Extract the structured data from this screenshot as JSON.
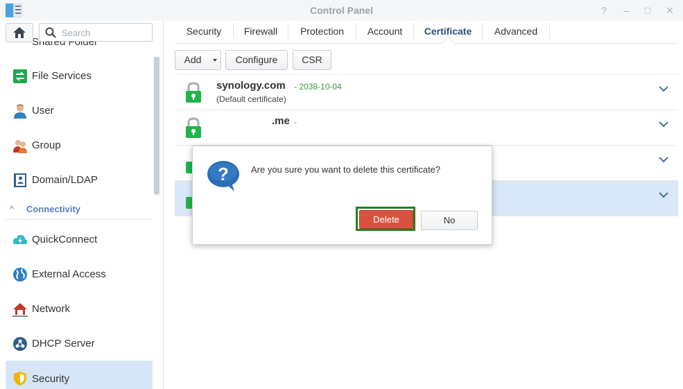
{
  "window": {
    "title": "Control Panel"
  },
  "window_controls": {
    "help": "?",
    "minimize": "–",
    "maximize": "□",
    "close": "×"
  },
  "search": {
    "placeholder": "Search",
    "value": ""
  },
  "sidebar": {
    "partial_item": "Shared Folder",
    "items": [
      {
        "label": "File Services",
        "icon": "file-services-icon"
      },
      {
        "label": "User",
        "icon": "user-icon"
      },
      {
        "label": "Group",
        "icon": "group-icon"
      },
      {
        "label": "Domain/LDAP",
        "icon": "domain-ldap-icon"
      }
    ],
    "section": {
      "label": "Connectivity",
      "chevron": "^"
    },
    "connectivity_items": [
      {
        "label": "QuickConnect",
        "icon": "quickconnect-icon"
      },
      {
        "label": "External Access",
        "icon": "external-access-icon"
      },
      {
        "label": "Network",
        "icon": "network-icon"
      },
      {
        "label": "DHCP Server",
        "icon": "dhcp-server-icon"
      },
      {
        "label": "Security",
        "icon": "security-shield-icon",
        "active": true
      }
    ]
  },
  "tabs": [
    "Security",
    "Firewall",
    "Protection",
    "Account",
    "Certificate",
    "Advanced"
  ],
  "active_tab": "Certificate",
  "toolbar": {
    "add": "Add",
    "configure": "Configure",
    "csr": "CSR"
  },
  "certificates": [
    {
      "name": "synology.com",
      "date": "- 2038-10-04",
      "subtitle": "(Default certificate)"
    },
    {
      "name": ".me",
      "date": "- ",
      "subtitle": ""
    }
  ],
  "dialog": {
    "message": "Are you sure you want to delete this certificate?",
    "icon_glyph": "?",
    "delete": "Delete",
    "no": "No"
  },
  "colors": {
    "accent": "#5a7dbf",
    "delete": "#d8533f",
    "highlight": "#2a7c22",
    "date": "#3aa13a",
    "lock": "#1fb44a",
    "selected_row": "#d8e8f8"
  }
}
